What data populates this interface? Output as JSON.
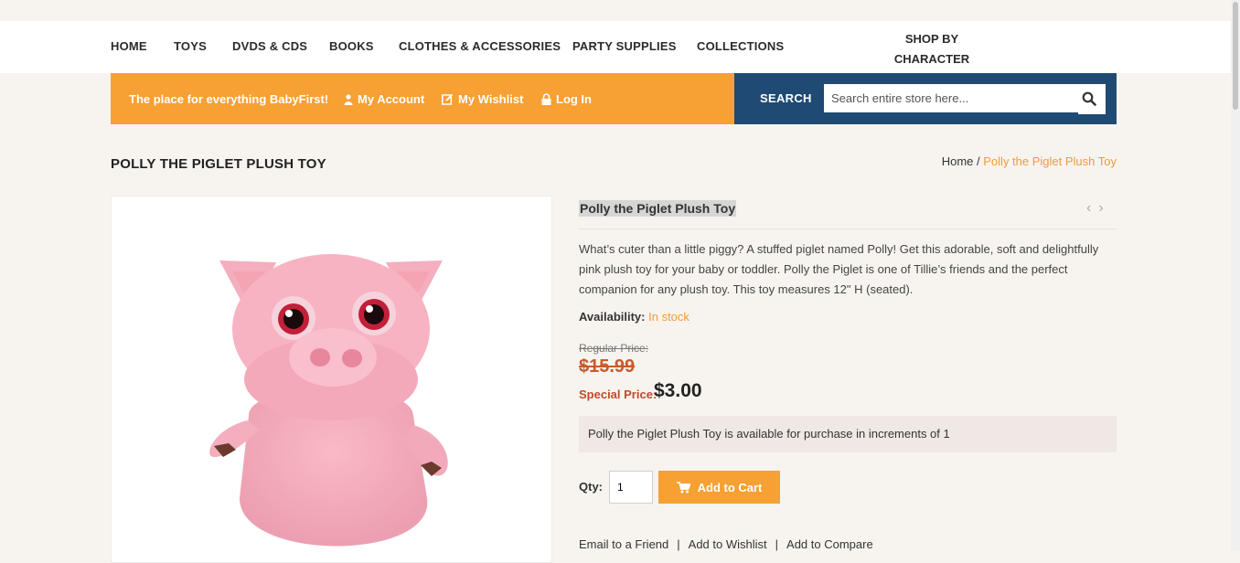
{
  "nav": {
    "items": [
      {
        "label": "HOME"
      },
      {
        "label": "TOYS"
      },
      {
        "label": "DVDS & CDS"
      },
      {
        "label": "BOOKS"
      },
      {
        "label": "CLOTHES & ACCESSORIES"
      },
      {
        "label": "PARTY SUPPLIES"
      },
      {
        "label": "COLLECTIONS"
      }
    ],
    "shop_by_line1": "SHOP BY",
    "shop_by_line2": "CHARACTER"
  },
  "topbar": {
    "tagline": "The place for everything BabyFirst!",
    "my_account": "My Account",
    "my_wishlist": "My Wishlist",
    "log_in": "Log In"
  },
  "search": {
    "label": "SEARCH",
    "placeholder": "Search entire store here..."
  },
  "page": {
    "title": "POLLY THE PIGLET PLUSH TOY",
    "breadcrumb_home": "Home",
    "breadcrumb_sep": " / ",
    "breadcrumb_current": "Polly the Piglet Plush Toy"
  },
  "product": {
    "name": "Polly the Piglet Plush Toy",
    "description": "What’s cuter than a little piggy? A stuffed piglet named Polly! Get this adorable, soft and delightfully pink plush toy for your baby or toddler. Polly the Piglet is one of Tillie’s friends and the perfect companion for any plush toy. This toy measures 12\" H (seated).",
    "availability_label": "Availability:",
    "availability_value": "In stock",
    "regular_price_label": "Regular Price:",
    "regular_price": "$15.99",
    "special_price_label": "Special Price:",
    "special_price": "$3.00",
    "increment_notice": "Polly the Piglet Plush Toy is available for purchase in increments of 1",
    "qty_label": "Qty:",
    "qty_value": "1",
    "add_to_cart": "Add to Cart",
    "email_friend": "Email to a Friend",
    "add_wishlist": "Add to Wishlist",
    "add_compare": "Add to Compare",
    "link_separator": "|"
  },
  "colors": {
    "accent_orange": "#f7a033",
    "navy": "#1f4a73",
    "link_orange": "#f39a36",
    "special_red": "#c24a2a"
  }
}
